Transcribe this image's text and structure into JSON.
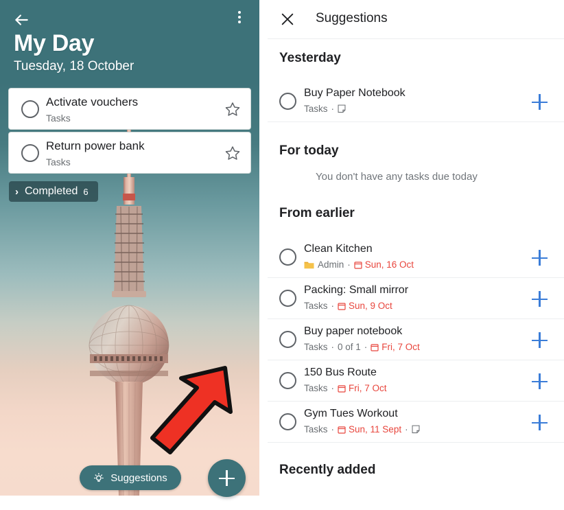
{
  "colors": {
    "teal": "#3d7279",
    "accent_blue": "#3b7dd8",
    "due_red": "#e8453c",
    "folder_yellow": "#f5c24a",
    "arrow_red": "#ee3124"
  },
  "left_panel": {
    "back_icon": "back-arrow-icon",
    "overflow_icon": "more-vertical-icon",
    "title": "My Day",
    "date": "Tuesday, 18 October",
    "tasks": [
      {
        "title": "Activate vouchers",
        "list": "Tasks",
        "star_icon": "star-outline-icon"
      },
      {
        "title": "Return power bank",
        "list": "Tasks",
        "star_icon": "star-outline-icon"
      }
    ],
    "completed": {
      "chevron": "›",
      "label": "Completed",
      "count": "6"
    },
    "suggestions_button": {
      "label": "Suggestions",
      "icon": "lightbulb-icon"
    },
    "fab": {
      "icon": "plus-icon"
    },
    "annotation": {
      "shape": "red-arrow",
      "points_to": "Suggestions"
    }
  },
  "right_panel": {
    "header": {
      "close_icon": "close-icon",
      "title": "Suggestions"
    },
    "sections": {
      "yesterday": "Yesterday",
      "for_today": "For today",
      "from_earlier": "From earlier",
      "recently_added": "Recently added"
    },
    "empty_today_text": "You don't have any tasks due today",
    "yesterday_items": [
      {
        "title": "Buy Paper Notebook",
        "list": "Tasks",
        "progress": "",
        "due": "",
        "has_folder": false,
        "folder_name": "",
        "has_note": true,
        "add_icon": "plus-icon"
      }
    ],
    "earlier_items": [
      {
        "title": "Clean Kitchen",
        "list": "Admin",
        "progress": "",
        "due": "Sun, 16 Oct",
        "has_folder": true,
        "folder_name": "Admin",
        "has_note": false,
        "add_icon": "plus-icon"
      },
      {
        "title": "Packing: Small mirror",
        "list": "Tasks",
        "progress": "",
        "due": "Sun, 9 Oct",
        "has_folder": false,
        "folder_name": "",
        "has_note": false,
        "add_icon": "plus-icon"
      },
      {
        "title": "Buy paper notebook",
        "list": "Tasks",
        "progress": "0 of 1",
        "due": "Fri, 7 Oct",
        "has_folder": false,
        "folder_name": "",
        "has_note": false,
        "add_icon": "plus-icon"
      },
      {
        "title": "150 Bus Route",
        "list": "Tasks",
        "progress": "",
        "due": "Fri, 7 Oct",
        "has_folder": false,
        "folder_name": "",
        "has_note": false,
        "add_icon": "plus-icon"
      },
      {
        "title": "Gym Tues Workout",
        "list": "Tasks",
        "progress": "",
        "due": "Sun, 11 Sept",
        "has_folder": false,
        "folder_name": "",
        "has_note": true,
        "add_icon": "plus-icon"
      }
    ]
  }
}
